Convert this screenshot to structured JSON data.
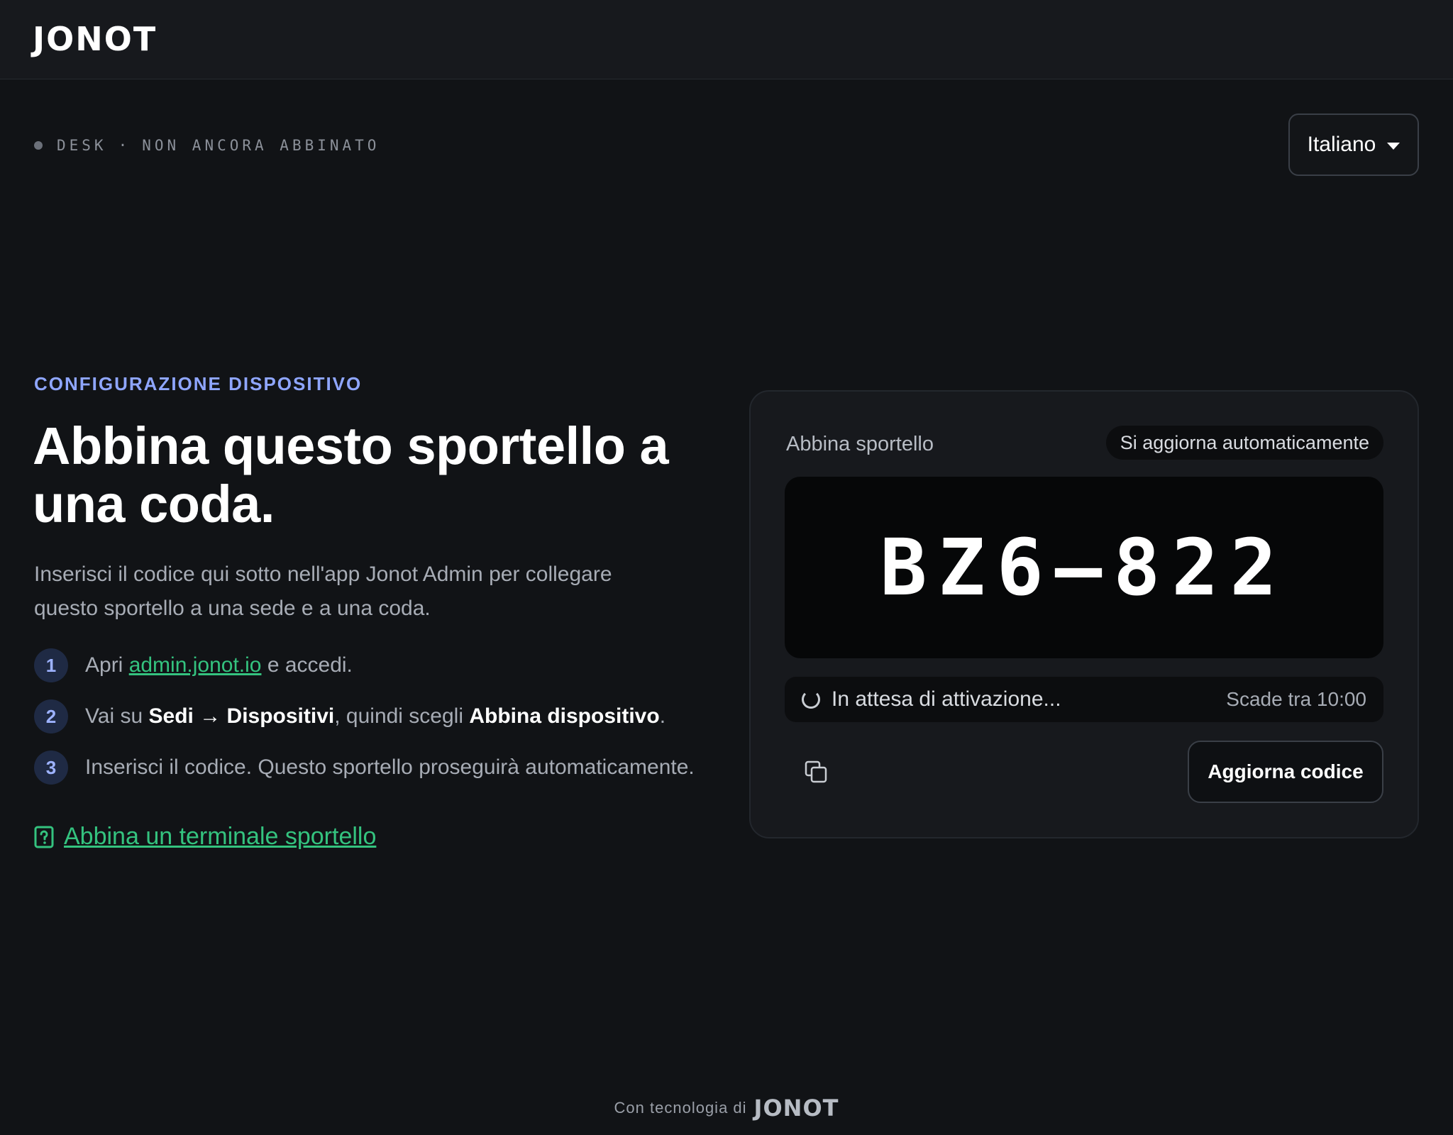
{
  "header": {
    "logo_text": "JONOT"
  },
  "status": {
    "device": "DESK",
    "separator": "·",
    "state": "NON ANCORA ABBINATO"
  },
  "language": {
    "selected": "Italiano"
  },
  "hero": {
    "eyebrow": "CONFIGURAZIONE DISPOSITIVO",
    "title": "Abbina questo sportello a una coda.",
    "intro": "Inserisci il codice qui sotto nell'app Jonot Admin per collegare questo sportello a una sede e a una coda."
  },
  "steps": [
    {
      "num": "1",
      "pre": "Apri ",
      "link": "admin.jonot.io",
      "post": " e accedi."
    },
    {
      "num": "2",
      "pre": "Vai su ",
      "bold1": "Sedi → Dispositivi",
      "mid": ", quindi scegli ",
      "bold2": "Abbina dispositivo",
      "post": "."
    },
    {
      "num": "3",
      "text": "Inserisci il codice. Questo sportello proseguirà automaticamente."
    }
  ],
  "help_link": {
    "label": "Abbina un terminale sportello",
    "icon": "help-document-icon"
  },
  "card": {
    "title": "Abbina sportello",
    "badge": "Si aggiorna automaticamente",
    "code": "BZ6–822",
    "waiting": "In attesa di attivazione...",
    "expires": "Scade tra 10:00",
    "copy_icon": "copy-icon",
    "refresh_label": "Aggiorna codice"
  },
  "footer": {
    "prefix": "Con tecnologia di",
    "logo_text": "JONOT"
  },
  "colors": {
    "accent_blue": "#8fa6ff",
    "link_green": "#34c37f",
    "background": "#111316"
  }
}
